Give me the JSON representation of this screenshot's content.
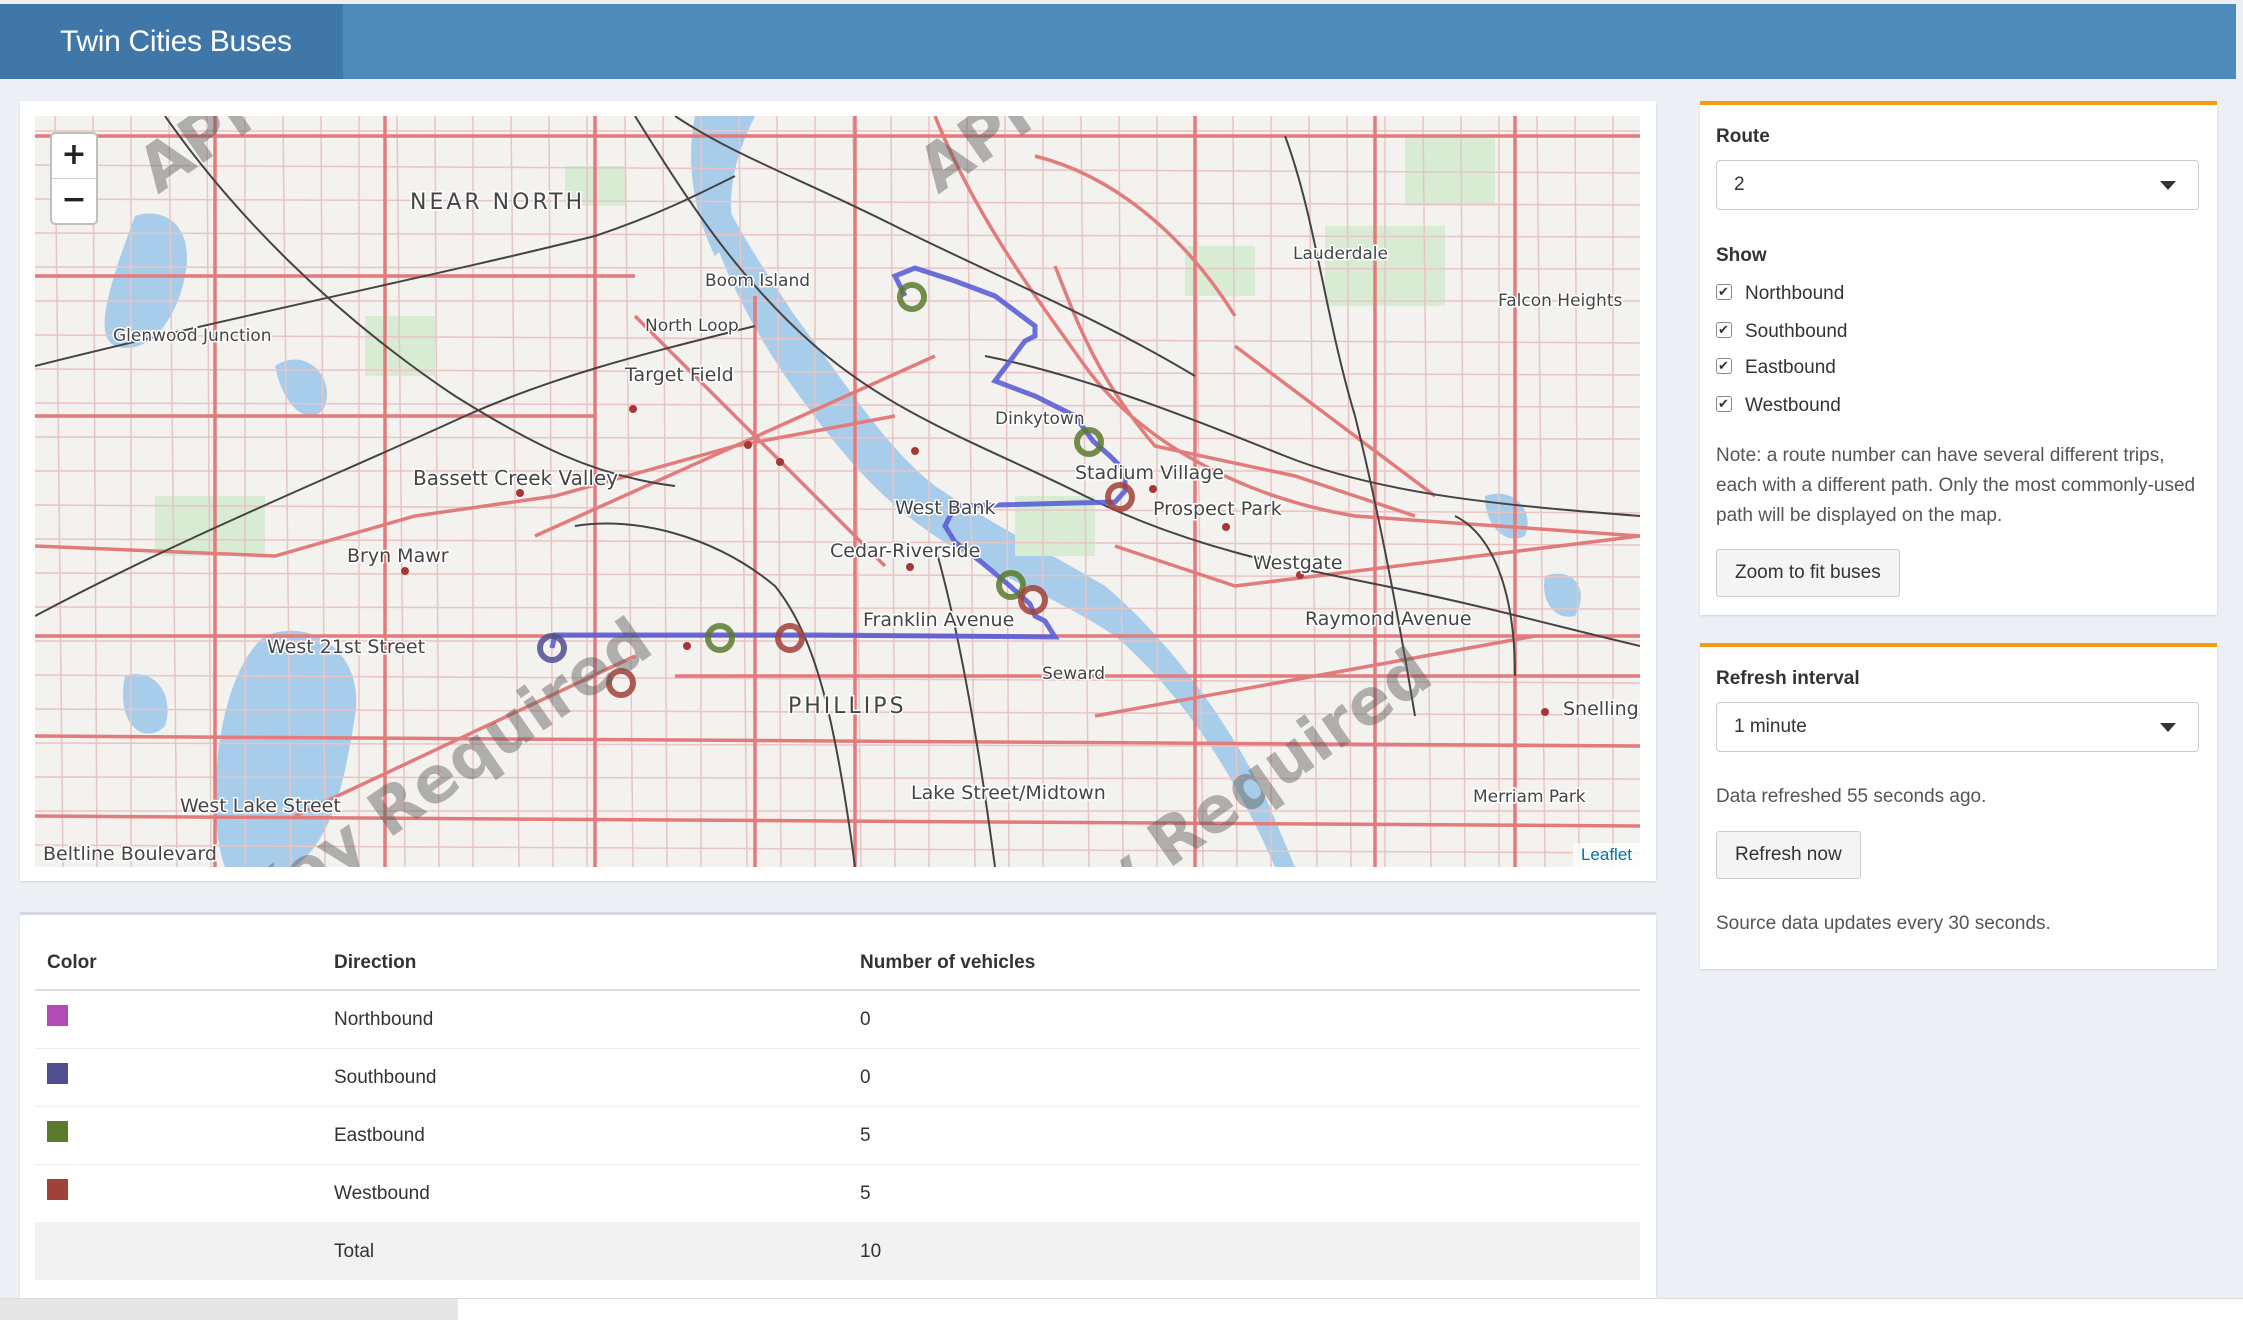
{
  "app": {
    "title": "Twin Cities Buses"
  },
  "map": {
    "zoom_in": "+",
    "zoom_out": "−",
    "attribution": "Leaflet",
    "watermarks": [
      "API",
      "API",
      "Key Required",
      "Key Required"
    ],
    "place_labels": [
      "NEAR NORTH",
      "Boom Island",
      "North Loop",
      "Target Field",
      "Glenwood Junction",
      "Lauderdale",
      "Falcon Heights",
      "Dinkytown",
      "Stadium Village",
      "Prospect Park",
      "West Bank",
      "Cedar-Riverside",
      "Bassett Creek Valley",
      "Bryn Mawr",
      "Westgate",
      "Raymond Avenue",
      "Franklin Avenue",
      "West 21st Street",
      "Seward",
      "PHILLIPS",
      "Snelling",
      "Lake Street/Midtown",
      "Merriam Park",
      "West Lake Street",
      "Beltline Boulevard"
    ],
    "colors": {
      "route": "#5b5fd6",
      "eastbound": "#5a7a2e",
      "westbound": "#a0423a",
      "southbound": "#4f4f8f",
      "northbound": "#b24bb3"
    }
  },
  "table": {
    "headers": {
      "color": "Color",
      "direction": "Direction",
      "count": "Number of vehicles"
    },
    "rows": [
      {
        "direction": "Northbound",
        "count": "0",
        "color": "#b24bb3"
      },
      {
        "direction": "Southbound",
        "count": "0",
        "color": "#4f4f8f"
      },
      {
        "direction": "Eastbound",
        "count": "5",
        "color": "#5a7a2e"
      },
      {
        "direction": "Westbound",
        "count": "5",
        "color": "#a0423a"
      }
    ],
    "total": {
      "label": "Total",
      "count": "10"
    }
  },
  "controls": {
    "route_label": "Route",
    "route_value": "2",
    "show_label": "Show",
    "checkboxes": [
      {
        "label": "Northbound",
        "checked": true
      },
      {
        "label": "Southbound",
        "checked": true
      },
      {
        "label": "Eastbound",
        "checked": true
      },
      {
        "label": "Westbound",
        "checked": true
      }
    ],
    "note": "Note: a route number can have several different trips, each with a different path. Only the most commonly-used path will be displayed on the map.",
    "zoom_button": "Zoom to fit buses"
  },
  "refresh": {
    "label": "Refresh interval",
    "value": "1 minute",
    "status": "Data refreshed 55 seconds ago.",
    "button": "Refresh now",
    "source_note": "Source data updates every 30 seconds."
  },
  "accent_color": "#f39c12",
  "header_color": "#4e8bbb"
}
